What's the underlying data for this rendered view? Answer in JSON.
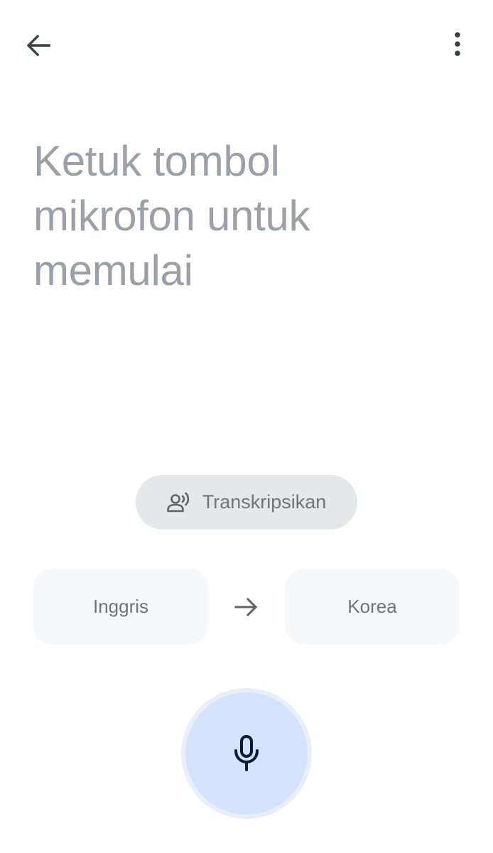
{
  "header": {
    "back_icon": "arrow-left-icon",
    "more_icon": "more-vert-icon"
  },
  "prompt": {
    "line1": "Ketuk tombol",
    "line2": "mikrofon untuk",
    "line3": "memulai"
  },
  "transcribe": {
    "icon": "voice-person-icon",
    "label": "Transkripsikan"
  },
  "languages": {
    "source": "Inggris",
    "arrow_icon": "arrow-right-icon",
    "target": "Korea"
  },
  "mic": {
    "icon": "mic-icon"
  },
  "colors": {
    "prompt_text": "#9aa0a6",
    "chip_bg": "#e6e7e8",
    "lang_bg": "#f5f8fa",
    "mic_bg": "#d4e3fb",
    "mic_ring": "#e8effb",
    "mic_icon": "#0b1a3a"
  }
}
